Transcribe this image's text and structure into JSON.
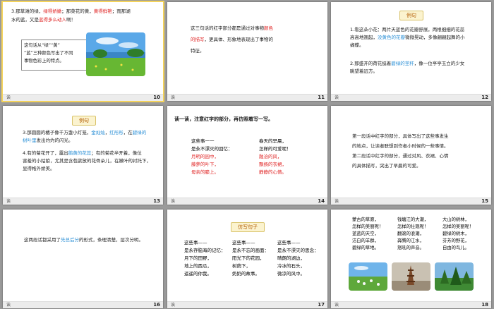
{
  "slides": {
    "s10": {
      "number": "10",
      "corner": "诶",
      "line1": {
        "a": "3.那草滩的绿，",
        "b": "绿得娇嫩",
        "c": "；那菜花的黄，",
        "d": "黄得鲜艳",
        "e": "；而那湖"
      },
      "line2": {
        "a": "水的蓝，又是",
        "b": "蓝得多么动人",
        "c": "啊！"
      },
      "box": [
        "这句话从“绿”“黄”",
        "“蓝”三种颜色写出了不同",
        "事物色彩上的特点。"
      ]
    },
    "s11": {
      "number": "11",
      "corner": "诶",
      "line1": {
        "a": "这三句话的红字部分都是通过对事物",
        "b": "颜色"
      },
      "line2": {
        "a": "的描写",
        "b": "，更具体、形象地表现出了事物的"
      },
      "line3": "特征。"
    },
    "s12": {
      "number": "12",
      "corner": "诶",
      "tag": "例句",
      "p1": [
        "1.看这朵小花：两片天蓝色的花瓣舒展，两根细细的花蕊",
        "高高地翘起，",
        "没黄色的花瓣",
        "微微晃动，多像翩翩起舞的小",
        "蝴蝶。"
      ],
      "p2": [
        "2.那盛开的荷花挺着",
        "碧绿的茎秆",
        "，像一位亭亭玉立的少女",
        "眺望着远方。"
      ]
    },
    "s13": {
      "number": "13",
      "corner": "诶",
      "tag": "例句",
      "p3": [
        "3.那圆圆的橘子像千万盏小灯笼，",
        "金灿灿",
        "，",
        "红彤彤",
        "，在",
        "碧绿的",
        "树叶里",
        "发出灼灼的闪光。"
      ],
      "p4": [
        "4.有的菊花开了，露出",
        "鹅黄的花蕊",
        "；有的菊花半开着，像位",
        "害羞的小姑娘，尤其是含苞欲放的花骨朵儿，在嫩叶的衬托下，",
        "显得格外娇美。"
      ]
    },
    "s14": {
      "number": "14",
      "corner": "诶",
      "title": "读一读，注意红字的部分，再仿照着写一写。",
      "left": [
        "这些事一一",
        "是永不漂灭的回忆：",
        "月明的园中，",
        "藤萝的叶下，",
        "母亲的膝上。"
      ],
      "right": [
        "春天的早晨，",
        "怎样的可爱呢！",
        "融洽的风，",
        "飘扬的衣裙，",
        "静静的心情。"
      ]
    },
    "s15": {
      "number": "15",
      "corner": "诶",
      "lines": [
        "第一段话中红字的部分，具体写出了这些事发生",
        "的地点，让读者联想到作者小时候的一些事情。",
        "第二段话中红字的部分，通过对风、衣裙、心情",
        "的具体描写，突出了早晨的可爱。"
      ]
    },
    "s16": {
      "number": "16",
      "corner": "诶",
      "line": {
        "a": "这两段话都采用了",
        "b": "先总后分",
        "c": "的形式，条理清楚，层次分明。"
      }
    },
    "s17": {
      "number": "17",
      "corner": "诶",
      "tag": "仿写句子",
      "c1": [
        "这些事——",
        "是永存脑海的记忆：",
        "月下的田野，",
        "地上的西瓜，",
        "遥遥的你我。"
      ],
      "c2": [
        "这些事——",
        "是永不忘的画面：",
        "阳光下的花园，",
        "树荫下，",
        "奶奶的故事。"
      ],
      "c3": [
        "这些事——",
        "是永不漂灭的思念：",
        "晴朗的湖边，",
        "冷冰的石头，",
        "微凉的风中。"
      ]
    },
    "s18": {
      "number": "18",
      "corner": "诶",
      "c1": [
        "蒙古的草原，",
        "怎样的美丽呢！",
        "蓝蓝的天空，",
        "洁白的羊群，",
        "碧绿的草地。"
      ],
      "c2": [
        "钱塘江的大潮，",
        "怎样的壮观呢！",
        "翻滚的浪潮，",
        "奔腾的江水，",
        "怒吼的声音。"
      ],
      "c3": [
        "大山的树林，",
        "怎样的美丽呢！",
        "碧绿的树木，",
        "芬芳的野花，",
        "自由的鸟儿。"
      ]
    }
  },
  "colors": {
    "accent_red": "#e02424",
    "accent_blue": "#2a8fd6",
    "tag_bg": "#fbf3cf",
    "background": "#9a9a9a"
  }
}
